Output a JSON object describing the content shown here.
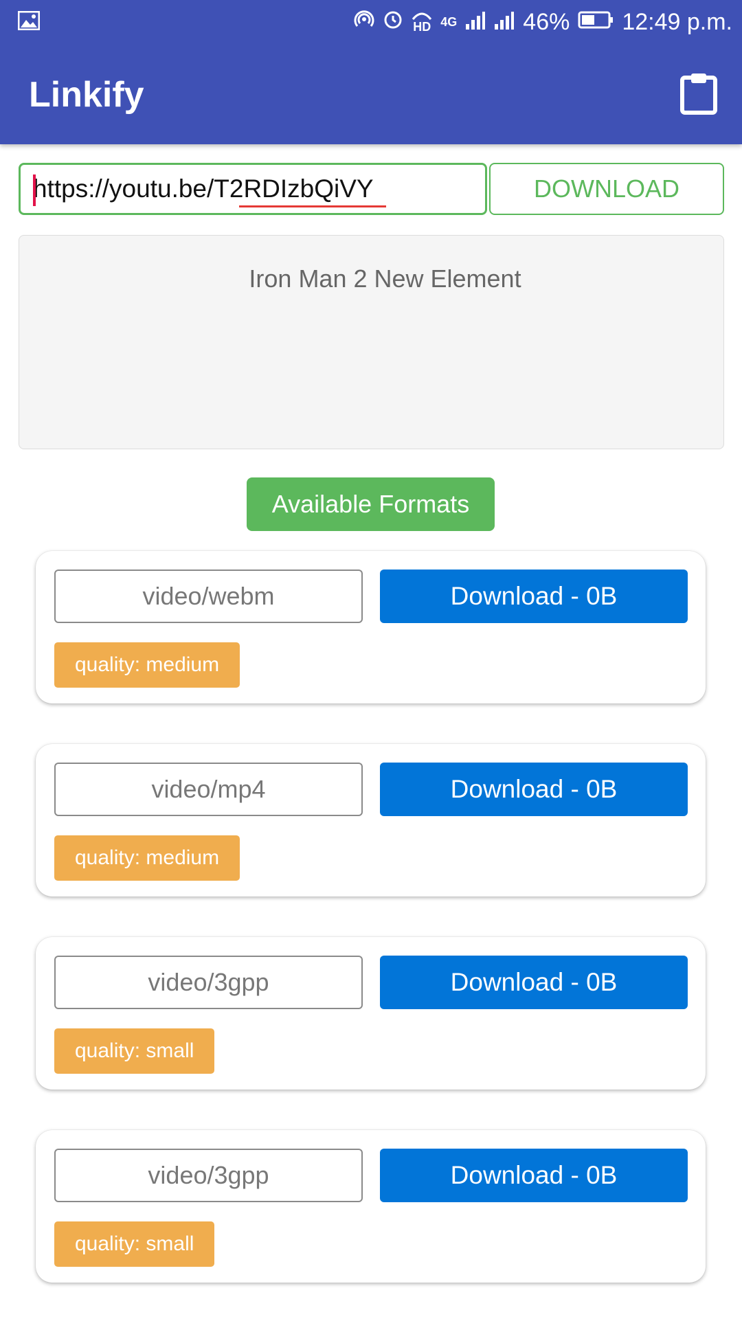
{
  "status_bar": {
    "battery": "46%",
    "time": "12:49 p.m.",
    "network": "4G",
    "hd": "HD",
    "icons": [
      "gallery-icon",
      "hotspot-icon",
      "alarm-icon",
      "hd-call-icon",
      "signal-icon",
      "signal-icon",
      "battery-icon"
    ]
  },
  "app_bar": {
    "title": "Linkify",
    "action_icon": "clipboard-icon"
  },
  "url_input": {
    "value": "https://youtu.be/T2RDIzbQiVY"
  },
  "download_button": {
    "label": "DOWNLOAD"
  },
  "video": {
    "title": "Iron Man 2 New Element"
  },
  "formats_button": {
    "label": "Available Formats"
  },
  "formats": [
    {
      "mime": "video/webm",
      "download_label": "Download - 0B",
      "quality": "quality: medium"
    },
    {
      "mime": "video/mp4",
      "download_label": "Download - 0B",
      "quality": "quality: medium"
    },
    {
      "mime": "video/3gpp",
      "download_label": "Download - 0B",
      "quality": "quality: small"
    },
    {
      "mime": "video/3gpp",
      "download_label": "Download - 0B",
      "quality": "quality: small"
    }
  ],
  "colors": {
    "app_bar": "#3f51b5",
    "success": "#5cb85c",
    "primary": "#0275d8",
    "warning": "#f0ad4e"
  }
}
